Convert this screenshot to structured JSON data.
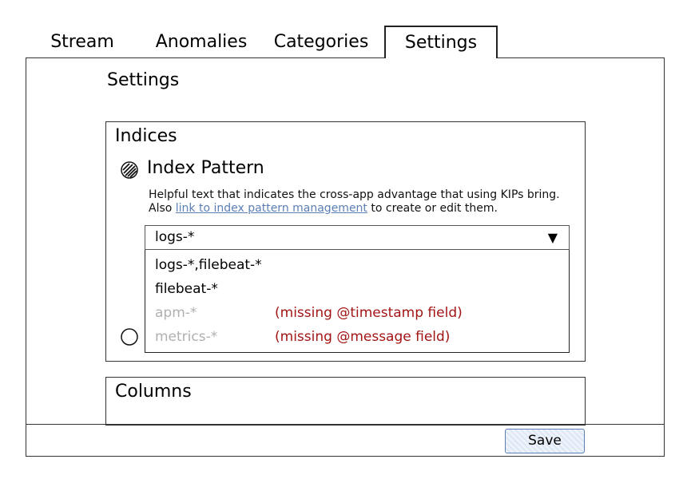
{
  "tabs": [
    {
      "label": "Stream",
      "active": false
    },
    {
      "label": "Anomalies",
      "active": false
    },
    {
      "label": "Categories",
      "active": false
    },
    {
      "label": "Settings",
      "active": true
    }
  ],
  "page": {
    "title": "Settings"
  },
  "indices": {
    "title": "Indices",
    "index_pattern_label": "Index Pattern",
    "help_text_before": "Helpful text that indicates the cross-app advantage that using KIPs bring. Also ",
    "help_link": "link to index pattern management",
    "help_text_after": " to create or edit them.",
    "select": {
      "value": "logs-*",
      "arrow": "▼",
      "options": [
        {
          "label": "logs-*,filebeat-*",
          "enabled": true,
          "warning": ""
        },
        {
          "label": "filebeat-*",
          "enabled": true,
          "warning": ""
        },
        {
          "label": "apm-*",
          "enabled": false,
          "warning": "(missing @timestamp field)"
        },
        {
          "label": "metrics-*",
          "enabled": false,
          "warning": "(missing @message field)"
        }
      ]
    }
  },
  "columns": {
    "title": "Columns"
  },
  "footer": {
    "save_label": "Save"
  },
  "colors": {
    "link": "#5b7fb5",
    "warning": "#a31515",
    "disabled": "#b0b0b0"
  },
  "icons": {
    "radio_selected": "radio-selected-icon",
    "radio_empty": "radio-empty-icon",
    "dropdown": "caret-down-icon"
  }
}
